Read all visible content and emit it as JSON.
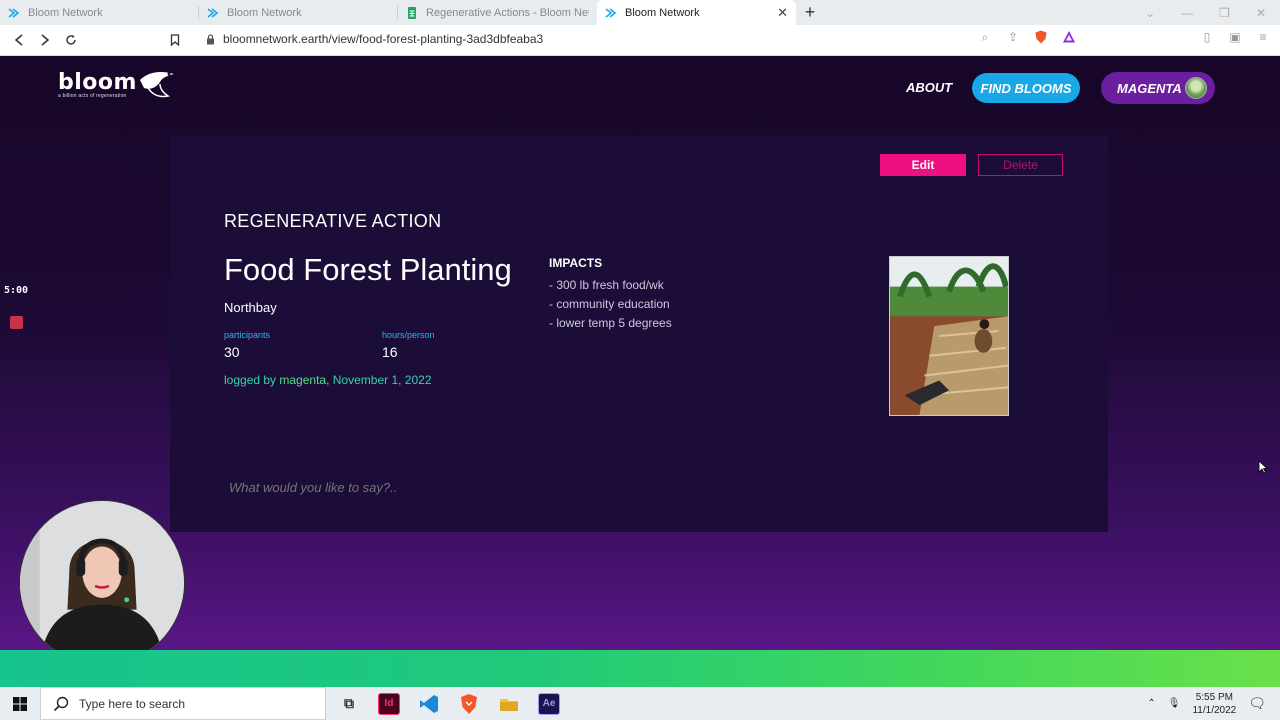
{
  "browser": {
    "tabs": [
      {
        "title": "Bloom Network",
        "active": false
      },
      {
        "title": "Bloom Network",
        "active": false
      },
      {
        "title": "Regenerative Actions - Bloom Network",
        "active": false
      },
      {
        "title": "Bloom Network",
        "active": true
      }
    ],
    "url": "bloomnetwork.earth/view/food-forest-planting-3ad3dbfeaba3"
  },
  "site": {
    "logo": {
      "word": "bloom",
      "tagline": "a billion acts of regeneration"
    },
    "nav": {
      "about": "ABOUT",
      "find": "FIND BLOOMS",
      "user": "MAGENTA"
    }
  },
  "action": {
    "edit_label": "Edit",
    "delete_label": "Delete",
    "kicker": "REGENERATIVE ACTION",
    "title": "Food Forest Planting",
    "location": "Northbay",
    "participants_label": "participants",
    "participants": "30",
    "hours_label": "hours/person",
    "hours": "16",
    "logged_prefix": "logged by ",
    "logged_user": "magenta",
    "logged_date": ", November 1, 2022",
    "impacts_title": "IMPACTS",
    "impacts": [
      "- 300 lb fresh food/wk",
      "- community education",
      "- lower temp 5 degrees"
    ],
    "comment_placeholder": "What would you like to say?.."
  },
  "overlay": {
    "timer": "5:00"
  },
  "taskbar": {
    "search_placeholder": "Type here to search",
    "apps": [
      "task-view",
      "indesign",
      "vscode",
      "brave",
      "file-explorer",
      "after-effects"
    ],
    "time": "5:55 PM",
    "date": "11/1/2022"
  },
  "colors": {
    "accent_pink": "#ef0f7e",
    "find_blue": "#1aa7e8",
    "user_purple": "#6b1e9e",
    "stat_label": "#29b6ea",
    "logged_teal": "#3ad1b1"
  }
}
